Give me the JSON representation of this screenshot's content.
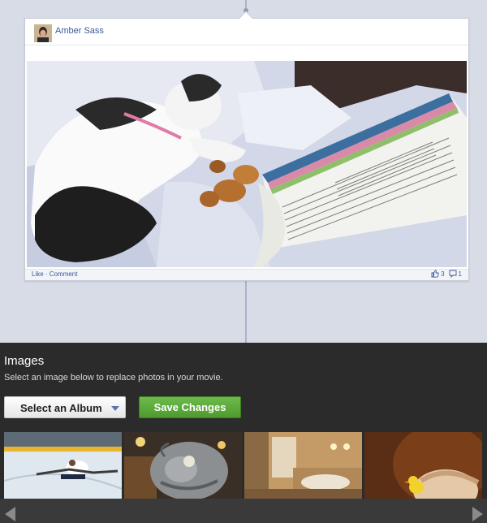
{
  "post": {
    "author": "Amber Sass",
    "footer": {
      "like": "Like",
      "separator": " · ",
      "comment": "Comment"
    },
    "counts": {
      "likes": "3",
      "comments": "1"
    },
    "colors": {
      "link": "#3b5998"
    }
  },
  "panel": {
    "title": "Images",
    "subtitle": "Select an image below to replace photos in your movie.",
    "album_button": "Select an Album",
    "save_button": "Save Changes",
    "colors": {
      "background": "#2b2b2b",
      "save_green": "#5aa83a",
      "arrow_blue": "#5b75b2"
    }
  },
  "thumbnails": [
    {
      "name": "thumb-ice-skater"
    },
    {
      "name": "thumb-stone-lion"
    },
    {
      "name": "thumb-bathroom"
    },
    {
      "name": "thumb-child-duck"
    }
  ],
  "icons": [
    "like-icon",
    "comment-icon",
    "chevron-down-icon",
    "arrow-left-icon",
    "arrow-right-icon"
  ]
}
